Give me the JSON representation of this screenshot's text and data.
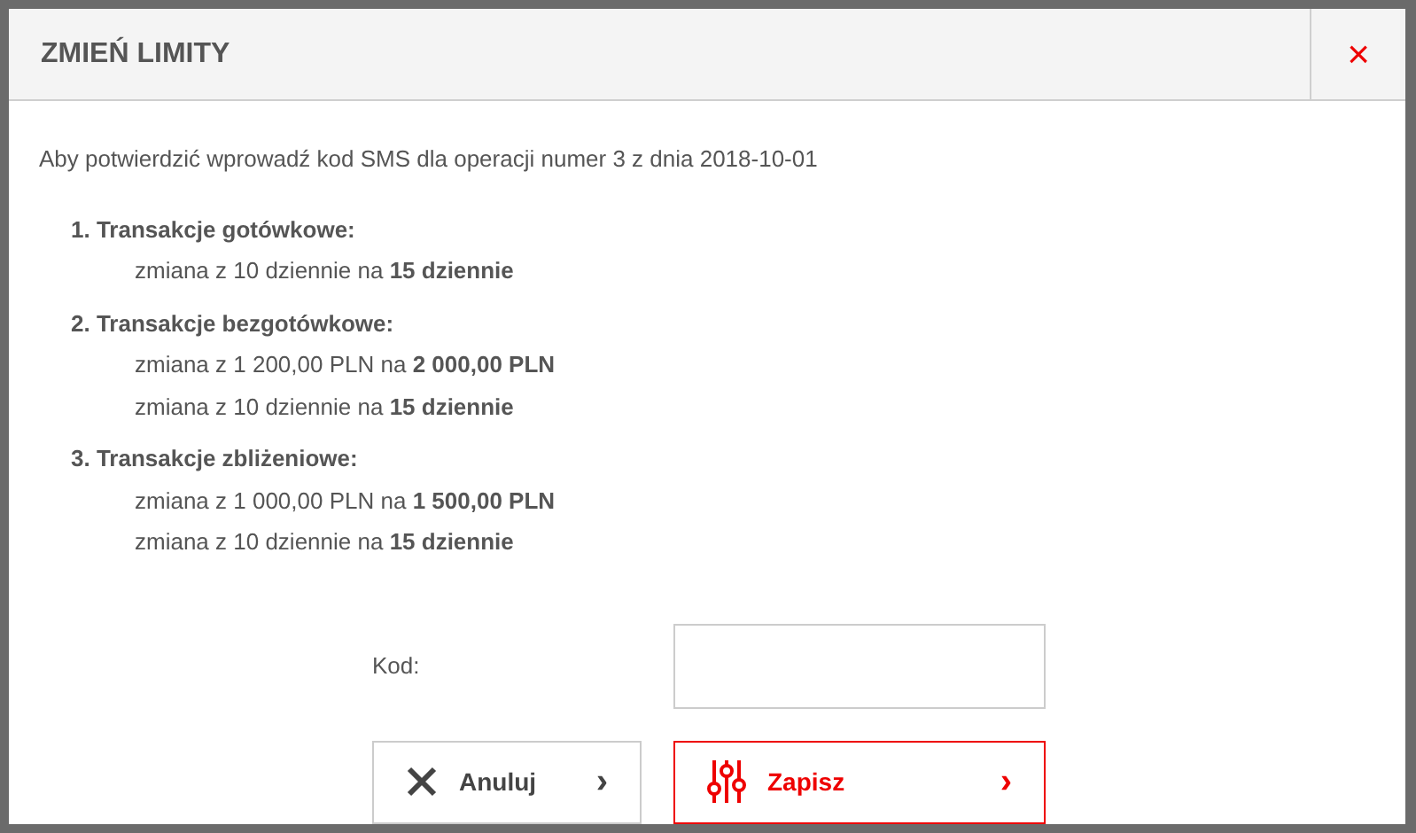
{
  "dialog": {
    "title": "ZMIEŃ LIMITY",
    "close": "×"
  },
  "intro": "Aby potwierdzić wprowadź kod SMS dla operacji numer 3 z dnia 2018-10-01",
  "changes": [
    {
      "heading": "1. Transakcje gotówkowe:",
      "lines": [
        "zmiana z 10 dziennie na **15 dziennie**"
      ]
    },
    {
      "heading": "2. Transakcje bezgotówkowe:",
      "lines": [
        "zmiana z 1 200,00 PLN na **2 000,00 PLN**",
        "zmiana z 10 dziennie na **15 dziennie**"
      ]
    },
    {
      "heading": "3. Transakcje zbliżeniowe:",
      "lines": [
        "zmiana z 1 000,00 PLN na **1 500,00 PLN**",
        "zmiana z 10 dziennie na **15 dziennie**"
      ]
    }
  ],
  "code_field": {
    "label": "Kod:"
  },
  "buttons": [
    {
      "label": "Anuluj",
      "kind": "cancel",
      "arrow": "›"
    },
    {
      "label": "Zapisz",
      "kind": "save",
      "arrow": "›"
    }
  ]
}
